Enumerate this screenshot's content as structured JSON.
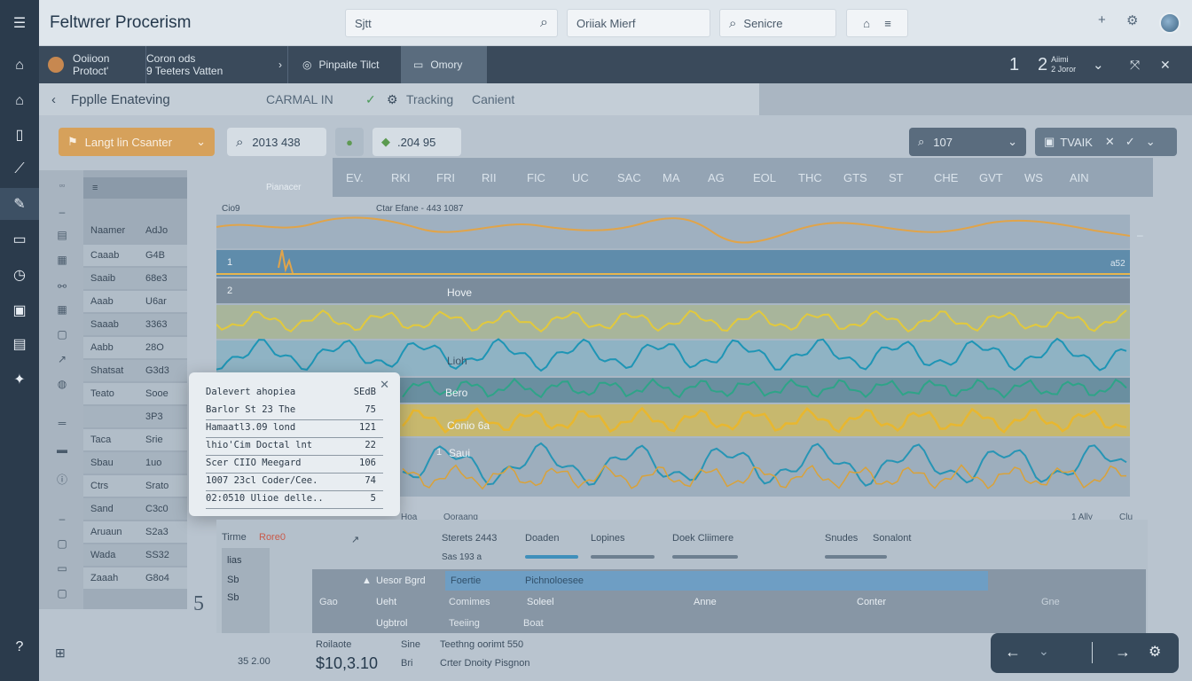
{
  "app": {
    "title": "Feltwrer Procerism"
  },
  "topbar": {
    "search_value": "Sjtt",
    "field2_value": "Oriiak Mierf",
    "field3_value": "Senicre",
    "colors": {
      "accent": "#e6a54a",
      "rail": "#2b3b4c"
    }
  },
  "context": {
    "seg1_line1": "Ooiioon",
    "seg1_line2": "Protoct'",
    "seg2_line1": "Coron ods",
    "seg2_line2": "9 Teeters Vatten",
    "seg3_label": "Pinpaite Tilct",
    "seg4_label": "Omory",
    "count1": "1",
    "count2": "2",
    "count2_sub1": "Aiimi",
    "count2_sub2": "2 Joror"
  },
  "breadcrumb": {
    "title": "Fpplle Enateving",
    "mid": "CARMAL IN",
    "tracking": "Tracking",
    "content": "Canient"
  },
  "filters": {
    "dropdown_label": "Langt lin Csanter",
    "search_value": "2013 438",
    "value_chip": ".204 95",
    "right_search": "107",
    "right_toggle": "TVAIK"
  },
  "left_table": {
    "header": [
      "Naamer",
      "AdJo"
    ],
    "rows": [
      [
        "Caaab",
        "G4B"
      ],
      [
        "Saaib",
        "68e3"
      ],
      [
        "Aaab",
        "U6ar"
      ],
      [
        "Saaab",
        "3363"
      ],
      [
        "Aabb",
        "28O"
      ],
      [
        "Shatsat",
        "G3d3"
      ],
      [
        "Teato",
        "Sooe"
      ],
      [
        "",
        "3P3"
      ],
      [
        "Taca",
        "Srie"
      ],
      [
        "Sbau",
        "1uo"
      ],
      [
        "Ctrs",
        "Srato"
      ],
      [
        "Sand",
        "C3c0"
      ],
      [
        "Aruaun",
        "S2a3"
      ],
      [
        "Wada",
        "SS32"
      ],
      [
        "Zaaah",
        "G8o4"
      ]
    ]
  },
  "chart": {
    "title_left": "Cio9",
    "title_mid": "Ctar Efane - 443 1087",
    "head_label": "Pianacer",
    "columns": [
      "EV.",
      "RKI",
      "FRI",
      "RII",
      "FIC",
      "UC",
      "SAC",
      "MA",
      "AG",
      "EOL",
      "THC",
      "GTS",
      "ST",
      "CHE",
      "GVT",
      "WS",
      "AIN"
    ],
    "band_labels": [
      "Hove",
      "Lioh",
      "Bero",
      "Conio 6a",
      "Saui"
    ],
    "band_num1": "1",
    "band_num2": "2",
    "band_num3": "1",
    "right_tag": "a52",
    "bottom_left": "Hoa",
    "bottom_mid": "Ooraang",
    "bottom_right1": "1 Ally",
    "bottom_right2": "Clu"
  },
  "popup": {
    "title": "Dalevert ahopiea",
    "title_value": "SEdB",
    "rows": [
      [
        "Barlor St 23 The",
        "75"
      ],
      [
        "Hamaatl3.09 lond",
        "121"
      ],
      [
        "lhio'Cim Doctal lnt",
        "22"
      ],
      [
        "Scer CIIO Meegard",
        "106"
      ],
      [
        "1007 23cl Coder/Cee.",
        "74"
      ],
      [
        "02:0510 Ulioe delle..",
        "5"
      ]
    ]
  },
  "bottom": {
    "time_label": "Tirme",
    "time_sub": "Rore0",
    "list_items": [
      "lias",
      "Sb",
      "Sb"
    ],
    "big_number": "5",
    "metrics": [
      "Sterets 2443",
      "Doaden",
      "Lopines",
      "Doek Cliimere",
      "Snudes",
      "Sonalont"
    ],
    "sub_metric": "Sas 193 a",
    "table_head": [
      "Uesor Bgrd",
      "Foertie",
      "Pichnoloesee"
    ],
    "row1": [
      "Gao",
      "Ueht",
      "Comimes",
      "Soleel",
      "Anne",
      "Conter",
      "Gne"
    ],
    "row2": [
      "Ugbtrol",
      "Teeiing",
      "Boat"
    ],
    "footer_label1": "Roilaote",
    "footer_label2": "Sine",
    "footer_label3": "Teethng oorimt 550",
    "footer_value": "$10,3.10",
    "footer_small": "Bri",
    "footer_label4": "Crter Dnoity Pisgnon",
    "footer_small2": "35 2.00"
  }
}
